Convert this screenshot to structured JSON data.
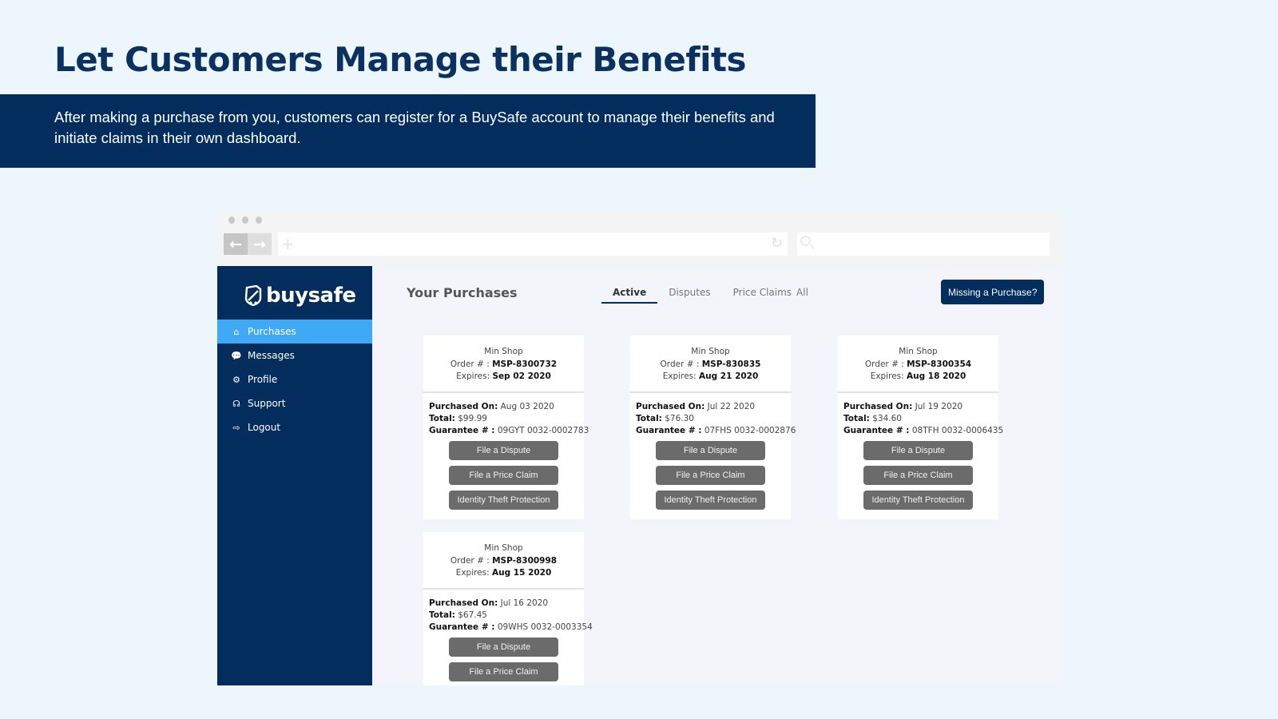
{
  "slide": {
    "title": "Let Customers Manage their Benefits",
    "description": "After making a purchase from you, customers can register for a BuySafe account to manage their benefits and initiate claims in their own dashboard."
  },
  "browser": {
    "back_icon": "←",
    "forward_icon": "→",
    "new_tab_icon": "+",
    "reload_icon": "↻"
  },
  "app": {
    "logo_text": "buysafe",
    "sidebar": {
      "items": [
        {
          "label": "Purchases",
          "icon": "home-icon",
          "glyph": "⌂",
          "active": true
        },
        {
          "label": "Messages",
          "icon": "chat-icon",
          "glyph": "💬",
          "active": false
        },
        {
          "label": "Profile",
          "icon": "gear-icon",
          "glyph": "⚙",
          "active": false
        },
        {
          "label": "Support",
          "icon": "headset-icon",
          "glyph": "☊",
          "active": false
        },
        {
          "label": "Logout",
          "icon": "logout-icon",
          "glyph": "⇨",
          "active": false
        }
      ]
    },
    "header": {
      "title": "Your Purchases",
      "tabs": [
        {
          "label": "Active",
          "active": true
        },
        {
          "label": "Disputes",
          "active": false
        },
        {
          "label": "Price Claims",
          "active": false
        },
        {
          "label": "All",
          "active": false
        }
      ],
      "missing_button": "Missing a Purchase?"
    },
    "labels": {
      "order": "Order # : ",
      "expires": "Expires: ",
      "purchased_on": "Purchased On:",
      "total": "Total:",
      "guarantee": "Guarantee # :"
    },
    "actions": {
      "dispute": "File a Dispute",
      "price_claim": "File a Price Claim",
      "identity": "Identity Theft Protection"
    },
    "purchases": [
      {
        "shop": "Min Shop",
        "order": "MSP-8300732",
        "expires": "Sep 02 2020",
        "purchased_on": "Aug 03 2020",
        "total": "$99.99",
        "guarantee": "09GYT 0032-0002783"
      },
      {
        "shop": "Min Shop",
        "order": "MSP-830835",
        "expires": "Aug 21 2020",
        "purchased_on": "Jul 22 2020",
        "total": "$76.30",
        "guarantee": "07FHS 0032-0002876"
      },
      {
        "shop": "Min Shop",
        "order": "MSP-8300354",
        "expires": "Aug 18 2020",
        "purchased_on": "Jul 19 2020",
        "total": "$34.60",
        "guarantee": "08TFH 0032-0006435"
      },
      {
        "shop": "Min Shop",
        "order": "MSP-8300998",
        "expires": "Aug 15 2020",
        "purchased_on": "Jul 16 2020",
        "total": "$67.45",
        "guarantee": "09WHS 0032-0003354"
      }
    ]
  }
}
